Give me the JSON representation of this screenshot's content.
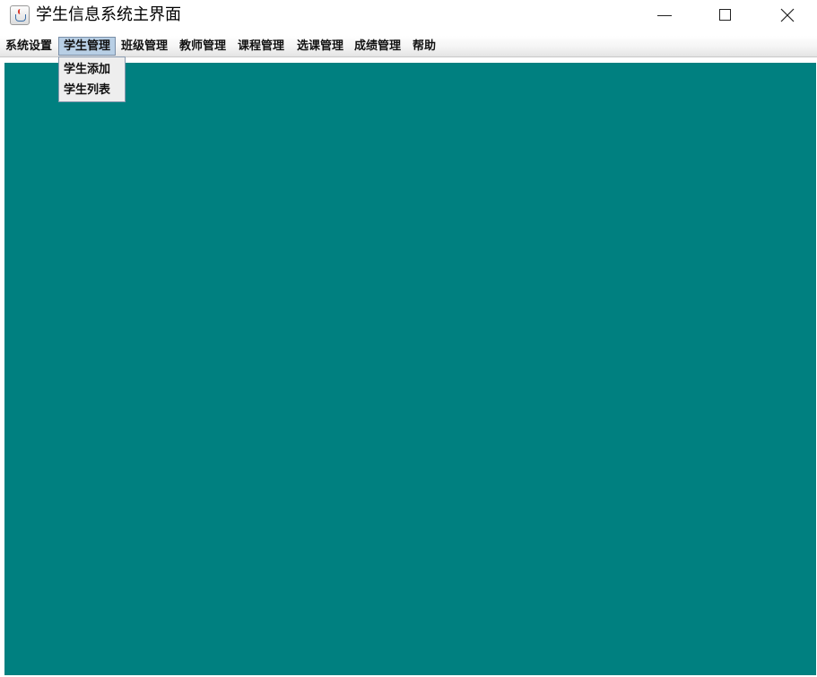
{
  "window": {
    "title": "学生信息系统主界面",
    "icon": "java-cup-icon"
  },
  "titlebar_buttons": {
    "minimize": "minimize-icon",
    "maximize": "maximize-icon",
    "close": "close-icon"
  },
  "menubar": {
    "items": [
      {
        "label": "系统设置"
      },
      {
        "label": "学生管理",
        "active": true
      },
      {
        "label": "班级管理"
      },
      {
        "label": "教师管理"
      },
      {
        "label": "课程管理"
      },
      {
        "label": "选课管理"
      },
      {
        "label": "成绩管理"
      },
      {
        "label": "帮助"
      }
    ]
  },
  "dropdown": {
    "items": [
      {
        "label": "学生添加"
      },
      {
        "label": "学生列表"
      }
    ]
  },
  "colors": {
    "desktop_background": "#008080",
    "menu_highlight": "#b8cfe5"
  }
}
